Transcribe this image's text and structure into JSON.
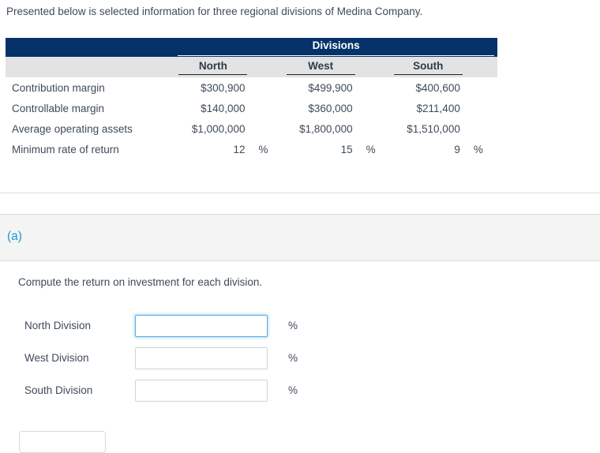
{
  "intro": {
    "text": "Presented below is selected information for three regional divisions of Medina Company."
  },
  "table": {
    "group_header": "Divisions",
    "columns": [
      "North",
      "West",
      "South"
    ],
    "rows": [
      {
        "label": "Contribution margin",
        "values": [
          "$300,900",
          "$499,900",
          "$400,600"
        ],
        "suffixes": [
          "",
          "",
          ""
        ]
      },
      {
        "label": "Controllable margin",
        "values": [
          "$140,000",
          "$360,000",
          "$211,400"
        ],
        "suffixes": [
          "",
          "",
          ""
        ]
      },
      {
        "label": "Average operating assets",
        "values": [
          "$1,000,000",
          "$1,800,000",
          "$1,510,000"
        ],
        "suffixes": [
          "",
          "",
          ""
        ]
      },
      {
        "label": "Minimum rate of return",
        "values": [
          "12",
          "15",
          "9"
        ],
        "suffixes": [
          "%",
          "%",
          "%"
        ]
      }
    ]
  },
  "part": {
    "letter": "(a)",
    "instruction": "Compute the return on investment for each division."
  },
  "answers": [
    {
      "label": "North Division",
      "value": "",
      "placeholder": "",
      "unit": "%"
    },
    {
      "label": "West Division",
      "value": "",
      "placeholder": "",
      "unit": "%"
    },
    {
      "label": "South Division",
      "value": "",
      "placeholder": "",
      "unit": "%"
    }
  ],
  "footer": {
    "button_label": ""
  },
  "colors": {
    "header_navy": "#043269",
    "subheader_gray": "#e3e3e3",
    "banner_gray": "#f4f4f4",
    "part_blue": "#199ad9",
    "focus_blue": "#5aaeea",
    "text": "#3e4a5a"
  }
}
